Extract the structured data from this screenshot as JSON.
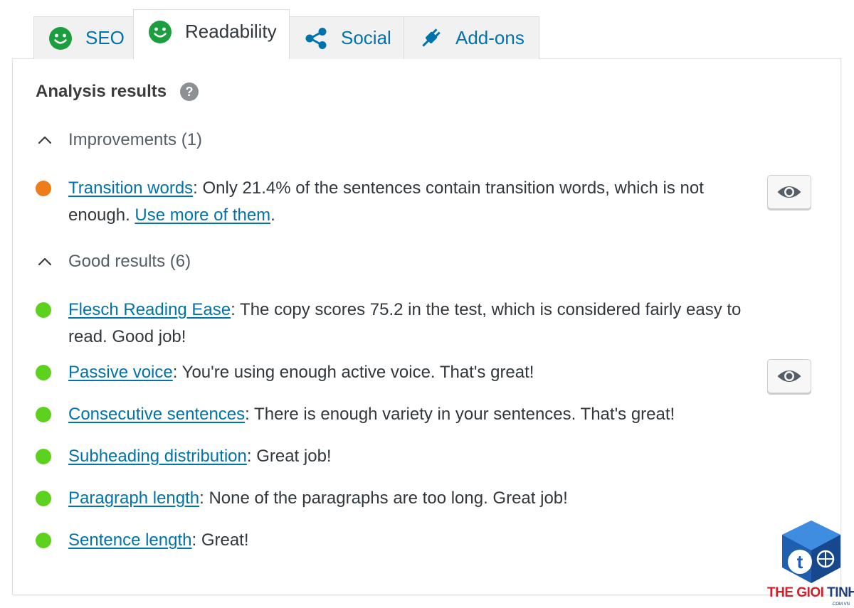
{
  "tabs": [
    {
      "label": "SEO",
      "icon": "smiley-face-icon",
      "active": false
    },
    {
      "label": "Readability",
      "icon": "smiley-face-icon",
      "active": true
    },
    {
      "label": "Social",
      "icon": "share-icon",
      "active": false
    },
    {
      "label": "Add-ons",
      "icon": "plug-icon",
      "active": false
    }
  ],
  "panel": {
    "heading": "Analysis results",
    "help_icon": "question-circle-icon"
  },
  "improvements": {
    "label": "Improvements (1)",
    "items": [
      {
        "link": "Transition words",
        "text_before": ": Only 21.4% of the sentences contain transition words, which is not enough. ",
        "link2": "Use more of them",
        "text_after": ".",
        "status": "orange"
      }
    ]
  },
  "good_results": {
    "label": "Good results (6)",
    "items": [
      {
        "link": "Flesch Reading Ease",
        "text": ": The copy scores 75.2 in the test, which is considered fairly easy to read. Good job!"
      },
      {
        "link": "Passive voice",
        "text": ": You're using enough active voice. That's great!"
      },
      {
        "link": "Consecutive sentences",
        "text": ": There is enough variety in your sentences. That's great!"
      },
      {
        "link": "Subheading distribution",
        "text": ": Great job!"
      },
      {
        "link": "Paragraph length",
        "text": ": None of the paragraphs are too long. Great job!"
      },
      {
        "link": "Sentence length",
        "text": ": Great!"
      }
    ]
  },
  "colors": {
    "link": "#0073aa",
    "good": "#5cd21f",
    "ok": "#ee7c1b",
    "smiley": "#1b9e3e",
    "panel_border": "#e1e1e1"
  },
  "watermark": {
    "part1": "THE GIOI",
    "part2": " TINHOC",
    "sub": ".COM.VN"
  }
}
